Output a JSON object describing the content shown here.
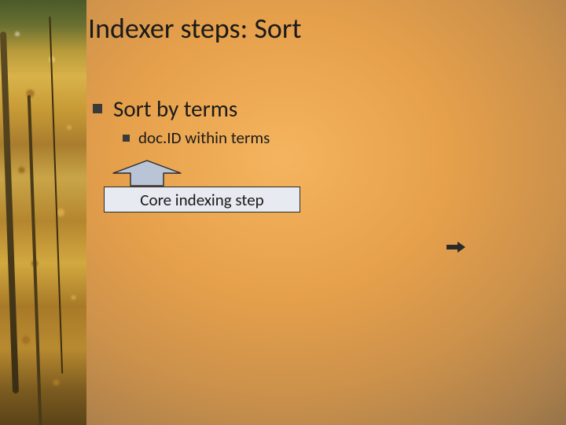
{
  "title": "Indexer steps: Sort",
  "bullets": {
    "l1": "Sort by terms",
    "l2": "doc.ID within terms"
  },
  "callout": "Core indexing step",
  "icons": {
    "up_arrow": "up-arrow-icon",
    "right_arrow": "right-arrow-icon"
  },
  "colors": {
    "arrow_fill": "#b9c4d6",
    "arrow_stroke": "#2a2a2a",
    "box_fill": "#e7eaf0"
  }
}
